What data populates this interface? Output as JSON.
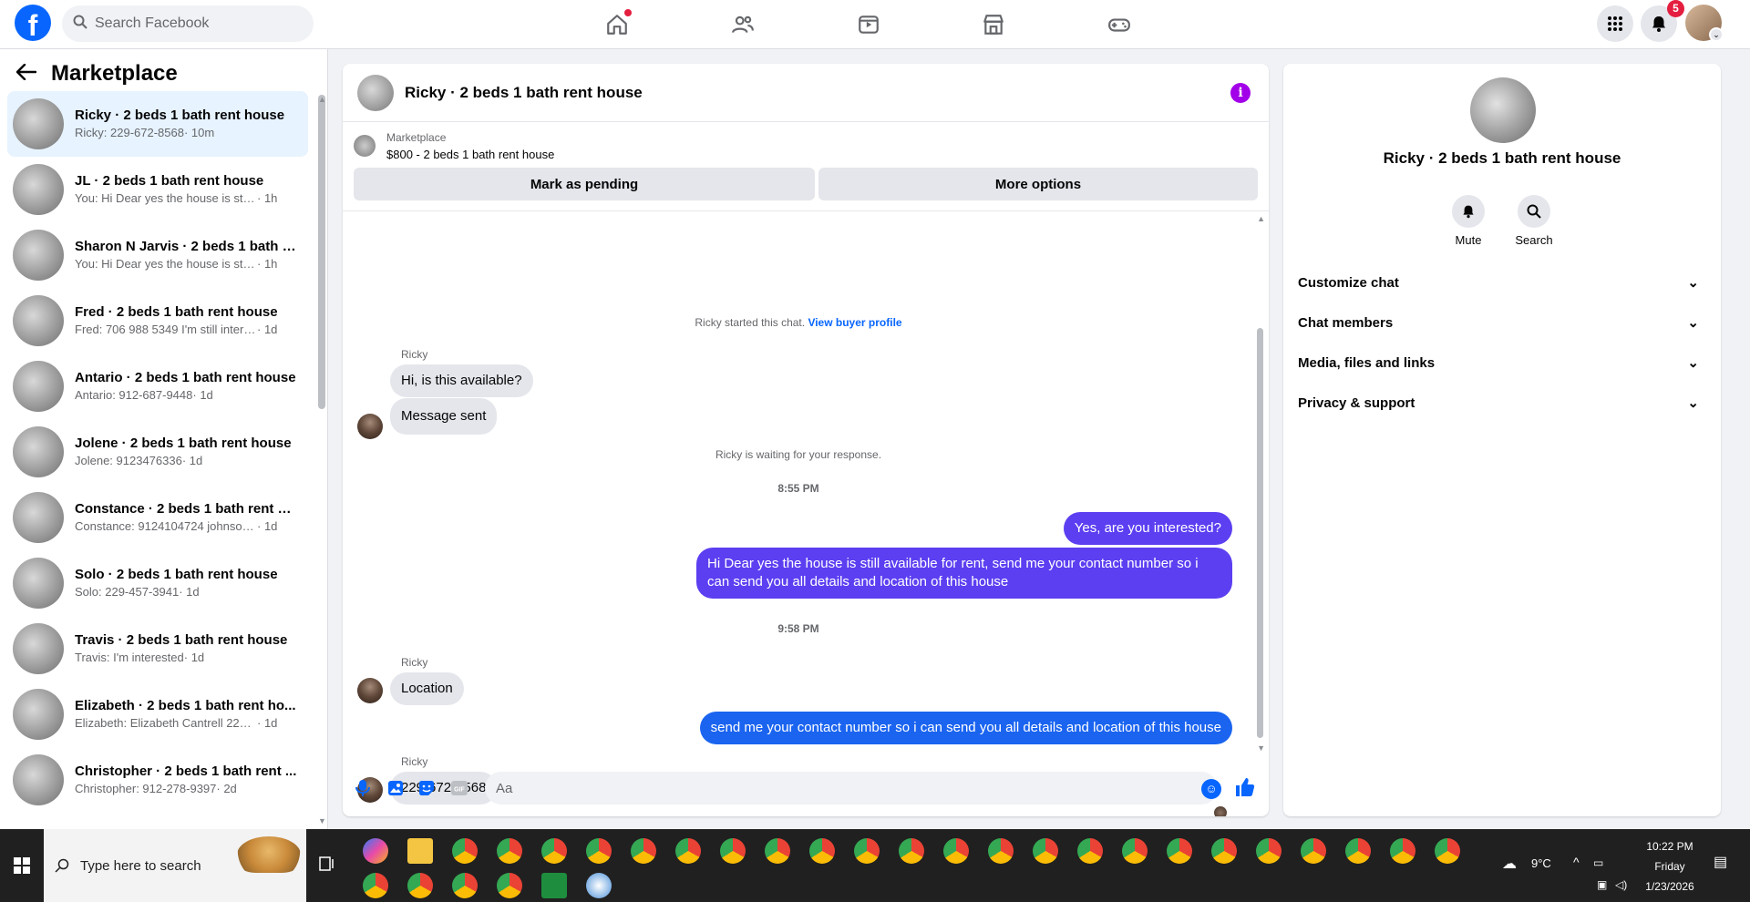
{
  "topbar": {
    "logo": "f",
    "search_placeholder": "Search Facebook",
    "notifications_count": "5",
    "nav_icons": [
      "home-icon",
      "friends-icon",
      "video-icon",
      "marketplace-icon",
      "gaming-icon"
    ]
  },
  "sidebar": {
    "title": "Marketplace",
    "conversations": [
      {
        "name": "Ricky · 2 beds 1 bath rent house",
        "preview": "Ricky: 229-672-8568",
        "time": " · 10m"
      },
      {
        "name": "JL · 2 beds 1 bath rent house",
        "preview": "You: Hi Dear yes the house is still a...",
        "time": " · 1h"
      },
      {
        "name": "Sharon N Jarvis · 2 beds 1 bath r...",
        "preview": "You: Hi Dear yes the house is still a...",
        "time": " · 1h"
      },
      {
        "name": "Fred · 2 beds 1 bath rent house",
        "preview": "Fred: 706 988 5349 I'm still interest...",
        "time": " · 1d"
      },
      {
        "name": "Antario · 2 beds 1 bath rent house",
        "preview": "Antario: 912-687-9448",
        "time": " · 1d"
      },
      {
        "name": "Jolene · 2 beds 1 bath rent house",
        "preview": "Jolene: 9123476336",
        "time": " · 1d"
      },
      {
        "name": "Constance · 2 beds 1 bath rent h...",
        "preview": "Constance: 9124104724 johnsonco...",
        "time": " · 1d"
      },
      {
        "name": "Solo · 2 beds 1 bath rent house",
        "preview": "Solo: 229-457-3941",
        "time": " · 1d"
      },
      {
        "name": "Travis · 2 beds 1 bath rent house",
        "preview": "Travis: I'm interested",
        "time": " · 1d"
      },
      {
        "name": "Elizabeth · 2 beds 1 bath rent ho...",
        "preview": "Elizabeth: Elizabeth Cantrell 229-56...",
        "time": " · 1d"
      },
      {
        "name": "Christopher · 2 beds 1 bath rent ...",
        "preview": "Christopher: 912-278-9397",
        "time": " · 2d"
      }
    ]
  },
  "chat": {
    "title": "Ricky · 2 beds 1 bath rent house",
    "listing_source": "Marketplace",
    "listing_price": "$800 - 2 beds 1 bath rent house",
    "mark_pending_label": "Mark as pending",
    "more_options_label": "More options",
    "started_text": "Ricky started this chat. ",
    "view_profile_label": "View buyer profile",
    "waiting_text": "Ricky is waiting for your response.",
    "sender": "Ricky",
    "time1": "8:55 PM",
    "time2": "9:58 PM",
    "msg_in_1": "Hi, is this available?",
    "msg_in_2": "Message sent",
    "msg_out_1": "Yes, are you interested?",
    "msg_out_2": "Hi Dear yes the house is still available for rent, send me your contact number so i can send you all details and location of this house",
    "msg_in_3": "Location",
    "msg_out_3": "send me your contact number so i can send you all details and location of this house",
    "msg_in_4": "229-672-8568",
    "input_placeholder": "Aa"
  },
  "right_panel": {
    "title": "Ricky · 2 beds 1 bath rent house",
    "mute_label": "Mute",
    "search_label": "Search",
    "sections": [
      "Customize chat",
      "Chat members",
      "Media, files and links",
      "Privacy & support"
    ]
  },
  "taskbar": {
    "search_placeholder": "Type here to search",
    "weather": "9°C",
    "time": "10:22 PM",
    "day": "Friday",
    "date": "1/23/2026"
  },
  "colors": {
    "accent": "#0866ff",
    "outgoing_bubble": "#5b3ff1",
    "incoming_bubble": "#e4e6eb",
    "badge": "#e41e3f"
  }
}
